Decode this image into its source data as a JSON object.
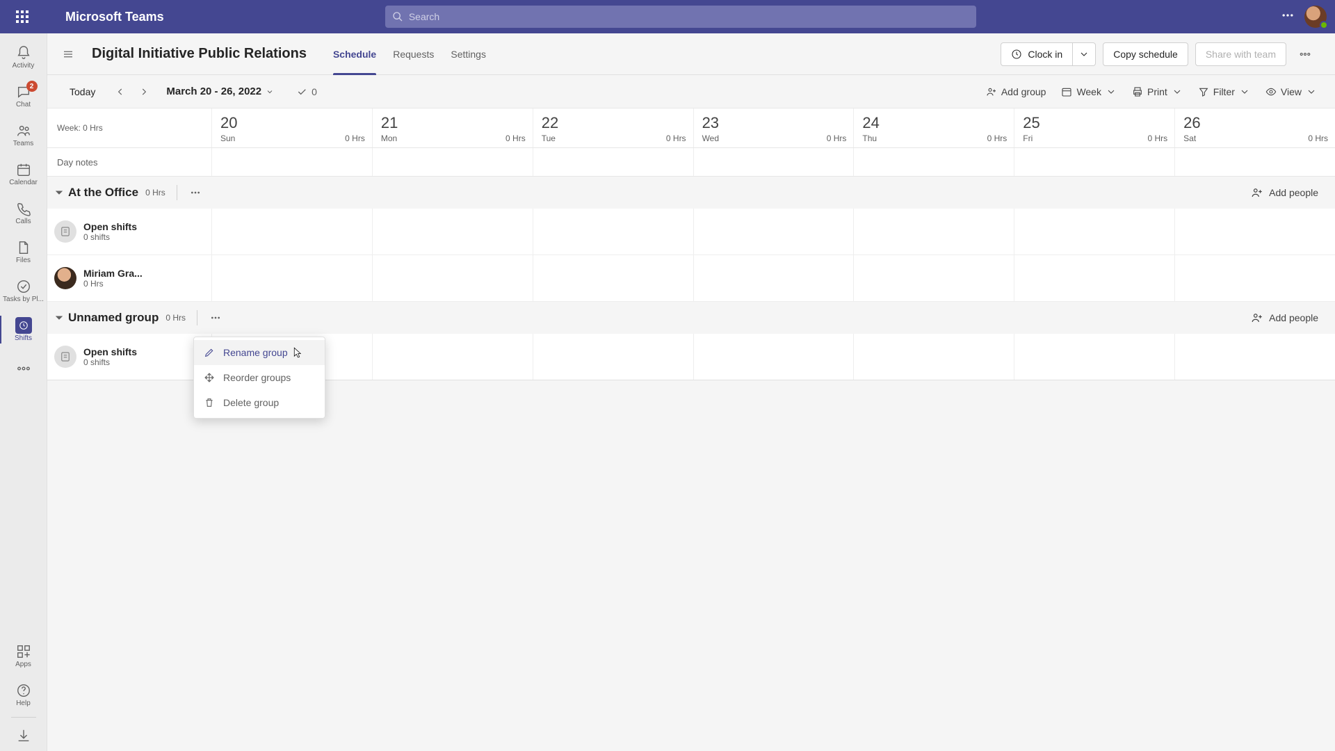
{
  "titlebar": {
    "app_title": "Microsoft Teams",
    "search_placeholder": "Search"
  },
  "leftrail": {
    "items": [
      {
        "label": "Activity",
        "icon": "bell"
      },
      {
        "label": "Chat",
        "icon": "chat",
        "badge": "2"
      },
      {
        "label": "Teams",
        "icon": "teams"
      },
      {
        "label": "Calendar",
        "icon": "calendar"
      },
      {
        "label": "Calls",
        "icon": "calls"
      },
      {
        "label": "Files",
        "icon": "files"
      },
      {
        "label": "Tasks by Pl...",
        "icon": "tasks"
      },
      {
        "label": "Shifts",
        "icon": "shifts",
        "active": true
      }
    ],
    "apps_label": "Apps",
    "help_label": "Help"
  },
  "page_header": {
    "team_name": "Digital Initiative Public Relations",
    "tabs": [
      {
        "label": "Schedule",
        "active": true
      },
      {
        "label": "Requests"
      },
      {
        "label": "Settings"
      }
    ],
    "clock_in": "Clock in",
    "copy_schedule": "Copy schedule",
    "share_with_team": "Share with team"
  },
  "cmdrow": {
    "today": "Today",
    "date_range": "March 20 - 26, 2022",
    "check_count": "0",
    "add_group": "Add group",
    "week": "Week",
    "print": "Print",
    "filter": "Filter",
    "view": "View"
  },
  "cal": {
    "week_label": "Week: 0 Hrs",
    "day_notes_label": "Day notes",
    "days": [
      {
        "num": "20",
        "name": "Sun",
        "hrs": "0 Hrs"
      },
      {
        "num": "21",
        "name": "Mon",
        "hrs": "0 Hrs"
      },
      {
        "num": "22",
        "name": "Tue",
        "hrs": "0 Hrs"
      },
      {
        "num": "23",
        "name": "Wed",
        "hrs": "0 Hrs"
      },
      {
        "num": "24",
        "name": "Thu",
        "hrs": "0 Hrs"
      },
      {
        "num": "25",
        "name": "Fri",
        "hrs": "0 Hrs"
      },
      {
        "num": "26",
        "name": "Sat",
        "hrs": "0 Hrs"
      }
    ]
  },
  "groups": [
    {
      "name": "At the Office",
      "hrs": "0 Hrs",
      "add_people": "Add people",
      "people": [
        {
          "name": "Open shifts",
          "sub": "0 shifts",
          "avatar": "open"
        },
        {
          "name": "Miriam Gra...",
          "sub": "0 Hrs",
          "avatar": "photo"
        }
      ]
    },
    {
      "name": "Unnamed group",
      "hrs": "0 Hrs",
      "add_people": "Add people",
      "people": [
        {
          "name": "Open shifts",
          "sub": "0 shifts",
          "avatar": "open"
        }
      ]
    }
  ],
  "ctxmenu": {
    "rename": "Rename group",
    "reorder": "Reorder groups",
    "delete": "Delete group"
  }
}
